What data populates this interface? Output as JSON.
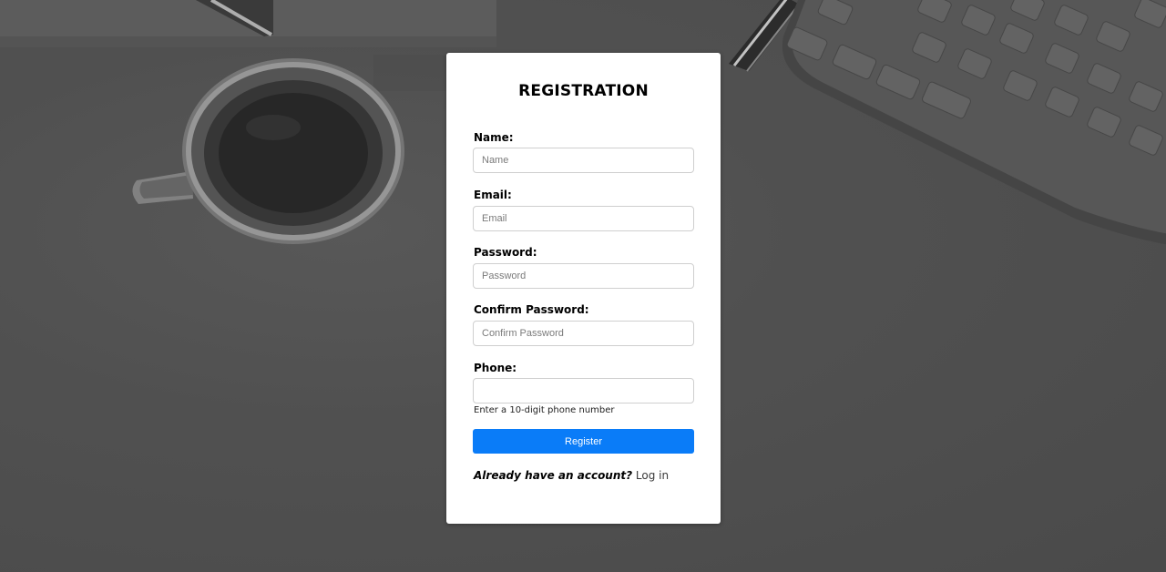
{
  "form": {
    "title": "REGISTRATION",
    "fields": [
      {
        "label": "Name:",
        "placeholder": "Name",
        "value": ""
      },
      {
        "label": "Email:",
        "placeholder": "Email",
        "value": ""
      },
      {
        "label": "Password:",
        "placeholder": "Password",
        "value": ""
      },
      {
        "label": "Confirm Password:",
        "placeholder": "Confirm Password",
        "value": ""
      },
      {
        "label": "Phone:",
        "placeholder": "",
        "value": ""
      }
    ],
    "phone_hint": "Enter a 10-digit phone number",
    "submit_label": "Register",
    "footer_question": "Already have an account?",
    "login_link_label": "Log in"
  },
  "colors": {
    "accent": "#0a7cf8",
    "card_background": "#ffffff",
    "page_background": "#575757"
  }
}
